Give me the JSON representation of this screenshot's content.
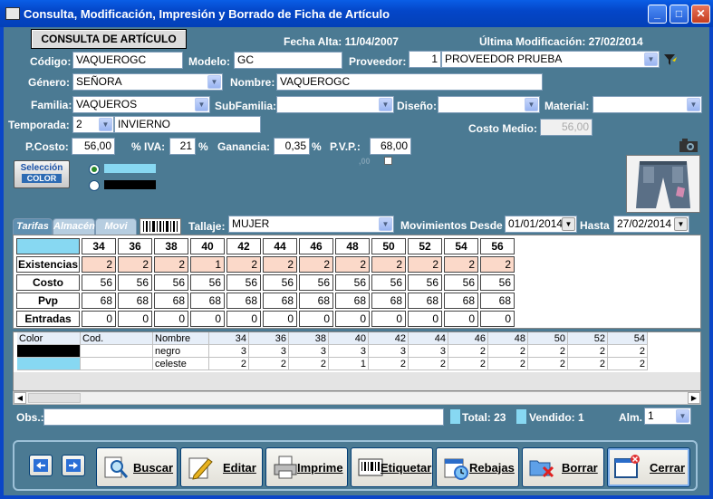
{
  "window": {
    "title": "Consulta, Modificación, Impresión y Borrado de Ficha de Artículo"
  },
  "header": {
    "mode_label": "CONSULTA DE ARTÍCULO",
    "fecha_alta": "Fecha Alta: 11/04/2007",
    "ultima_mod": "Última Modificación: 27/02/2014"
  },
  "form": {
    "codigo_label": "Código:",
    "codigo": "VAQUEROGC",
    "modelo_label": "Modelo:",
    "modelo": "GC",
    "proveedor_label": "Proveedor:",
    "proveedor_num": "1",
    "proveedor": "PROVEEDOR PRUEBA",
    "genero_label": "Género:",
    "genero": "SEÑORA",
    "nombre_label": "Nombre:",
    "nombre": "VAQUEROGC",
    "familia_label": "Familia:",
    "familia": "VAQUEROS",
    "subfamilia_label": "SubFamilia:",
    "subfamilia": "",
    "diseno_label": "Diseño:",
    "diseno": "",
    "material_label": "Material:",
    "material": "",
    "temporada_label": "Temporada:",
    "temporada_num": "2",
    "temporada": "INVIERNO",
    "costo_medio_label": "Costo Medio:",
    "costo_medio": "56,00",
    "pcosto_label": "P.Costo:",
    "pcosto": "56,00",
    "iva_label": "% IVA:",
    "iva": "21",
    "iva_pct": "%",
    "ganancia_label": "Ganancia:",
    "ganancia": "0,35",
    "ganancia_pct": "%",
    "pvp_label": "P.V.P.:",
    "pvp": "68,00",
    "small_value": ",00"
  },
  "seleccion": {
    "line1": "Selección",
    "line2": "COLOR"
  },
  "colors": {
    "celeste": "#87d8f2",
    "negro": "#000000",
    "peach": "#fbd9c9"
  },
  "tabs": [
    {
      "label": "Tarifas"
    },
    {
      "label": "Almacén"
    },
    {
      "label": "Movi"
    }
  ],
  "talla": {
    "tallaje_label": "Tallaje:",
    "tallaje": "MUJER",
    "mov_label": "Movimientos Desde",
    "desde": "01/01/2014",
    "hasta_label": "Hasta",
    "hasta": "27/02/2014"
  },
  "grid": {
    "sizes": [
      "34",
      "36",
      "38",
      "40",
      "42",
      "44",
      "46",
      "48",
      "50",
      "52",
      "54",
      "56"
    ],
    "rows": [
      {
        "label": "Existencias",
        "values": [
          "2",
          "2",
          "2",
          "1",
          "2",
          "2",
          "2",
          "2",
          "2",
          "2",
          "2",
          "2"
        ]
      },
      {
        "label": "Costo",
        "values": [
          "56",
          "56",
          "56",
          "56",
          "56",
          "56",
          "56",
          "56",
          "56",
          "56",
          "56",
          "56"
        ]
      },
      {
        "label": "Pvp",
        "values": [
          "68",
          "68",
          "68",
          "68",
          "68",
          "68",
          "68",
          "68",
          "68",
          "68",
          "68",
          "68"
        ]
      },
      {
        "label": "Entradas",
        "values": [
          "0",
          "0",
          "0",
          "0",
          "0",
          "0",
          "0",
          "0",
          "0",
          "0",
          "0",
          "0"
        ]
      }
    ]
  },
  "color_table": {
    "headers": [
      "Color",
      "Cod.",
      "Nombre",
      "34",
      "36",
      "38",
      "40",
      "42",
      "44",
      "46",
      "48",
      "50",
      "52",
      "54"
    ],
    "rows": [
      {
        "name": "negro",
        "values": [
          "3",
          "3",
          "3",
          "3",
          "3",
          "3",
          "2",
          "2",
          "2",
          "2",
          "2"
        ]
      },
      {
        "name": "celeste",
        "values": [
          "2",
          "2",
          "2",
          "1",
          "2",
          "2",
          "2",
          "2",
          "2",
          "2",
          "2"
        ]
      }
    ]
  },
  "footer": {
    "obs_label": "Obs.:",
    "obs": "",
    "total": "Total: 23",
    "vendido": "Vendido: 1",
    "alm_label": "Alm.",
    "alm": "1"
  },
  "buttons": {
    "buscar": "Buscar",
    "editar": "Editar",
    "imprime": "Imprime",
    "etiquetar": "Etiquetar",
    "rebajas": "Rebajas",
    "borrar": "Borrar",
    "cerrar": "Cerrar"
  }
}
